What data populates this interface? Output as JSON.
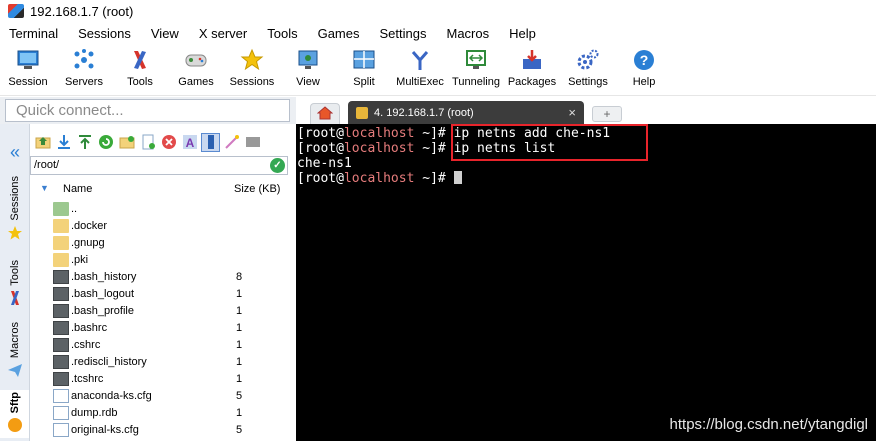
{
  "window": {
    "title": "192.168.1.7 (root)"
  },
  "menu": [
    "Terminal",
    "Sessions",
    "View",
    "X server",
    "Tools",
    "Games",
    "Settings",
    "Macros",
    "Help"
  ],
  "toolbar": [
    {
      "label": "Session",
      "icon": "session-icon"
    },
    {
      "label": "Servers",
      "icon": "servers-icon"
    },
    {
      "label": "Tools",
      "icon": "tools-icon"
    },
    {
      "label": "Games",
      "icon": "games-icon"
    },
    {
      "label": "Sessions",
      "icon": "star-icon"
    },
    {
      "label": "View",
      "icon": "view-icon"
    },
    {
      "label": "Split",
      "icon": "split-icon"
    },
    {
      "label": "MultiExec",
      "icon": "multiexec-icon"
    },
    {
      "label": "Tunneling",
      "icon": "tunneling-icon"
    },
    {
      "label": "Packages",
      "icon": "packages-icon"
    },
    {
      "label": "Settings",
      "icon": "settings-icon"
    },
    {
      "label": "Help",
      "icon": "help-icon"
    }
  ],
  "quick_connect": {
    "placeholder": "Quick connect..."
  },
  "tabs": {
    "session_tab": "4. 192.168.1.7 (root)"
  },
  "sidebar": {
    "tabs": [
      "Sessions",
      "Tools",
      "Macros",
      "Sftp"
    ]
  },
  "file_browser": {
    "path": "/root/",
    "columns": {
      "name": "Name",
      "size": "Size (KB)"
    },
    "files": [
      {
        "name": "..",
        "size": "",
        "type": "up"
      },
      {
        "name": ".docker",
        "size": "",
        "type": "folder"
      },
      {
        "name": ".gnupg",
        "size": "",
        "type": "folder"
      },
      {
        "name": ".pki",
        "size": "",
        "type": "folder"
      },
      {
        "name": ".bash_history",
        "size": "8",
        "type": "term"
      },
      {
        "name": ".bash_logout",
        "size": "1",
        "type": "term"
      },
      {
        "name": ".bash_profile",
        "size": "1",
        "type": "term"
      },
      {
        "name": ".bashrc",
        "size": "1",
        "type": "term"
      },
      {
        "name": ".cshrc",
        "size": "1",
        "type": "term"
      },
      {
        "name": ".rediscli_history",
        "size": "1",
        "type": "term"
      },
      {
        "name": ".tcshrc",
        "size": "1",
        "type": "term"
      },
      {
        "name": "anaconda-ks.cfg",
        "size": "5",
        "type": "doc"
      },
      {
        "name": "dump.rdb",
        "size": "1",
        "type": "doc"
      },
      {
        "name": "original-ks.cfg",
        "size": "5",
        "type": "doc"
      }
    ]
  },
  "terminal": {
    "lines": [
      {
        "user": "[root@",
        "host": "localhost",
        "rest": " ~]# ",
        "cmd": "ip netns add che-ns1"
      },
      {
        "user": "[root@",
        "host": "localhost",
        "rest": " ~]# ",
        "cmd": "ip netns list"
      },
      {
        "output": "che-ns1"
      },
      {
        "user": "[root@",
        "host": "localhost",
        "rest": " ~]# ",
        "cmd": ""
      }
    ],
    "watermark": "https://blog.csdn.net/ytangdigl"
  },
  "colors": {
    "terminal_bg": "#000000",
    "host_color": "#e67c7c",
    "highlight_border": "#e8242b"
  }
}
